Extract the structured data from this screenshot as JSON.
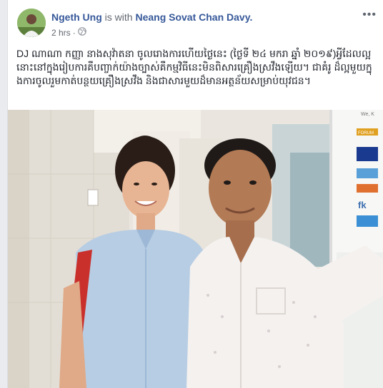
{
  "post": {
    "author": "Ngeth Ung",
    "with_text": "is with",
    "tagged": "Neang Sovat Chan Davy.",
    "time": "2 hrs",
    "privacy_icon": "globe-icon",
    "more_icon": "more-options-icon",
    "more_label": "•••",
    "text": "DJ ណាណា កញ្ញា នាងសុវ៉ាតនា ចូលរោងការហើយថ្ងៃនេះ (ថ្ងៃទី ២៤ មករា ឆ្នាំ ២០១៩)អ្វីដែលល្អនោះនៅក្នុងរៀបការគឺបញ្ចាក់យ៉ាងច្បាស់គឺកម្មវិធីនេះមិនពិសារគ្រឿងស្រវឹងឡើយ។ ជាគំរូ ដ៏ល្អមួយក្នុងការចូលរួមកាត់បន្ថយគ្រឿងស្រវឹង និងជាសារមួយដ៏មានអត្ថន័យសម្រាប់យុវជន។"
  },
  "banner": {
    "lines": [
      "We, K",
      "FORUM",
      "fk"
    ]
  },
  "colors": {
    "link": "#365899",
    "text": "#1d2129",
    "meta": "#616770",
    "page_bg": "#e9ebee"
  }
}
